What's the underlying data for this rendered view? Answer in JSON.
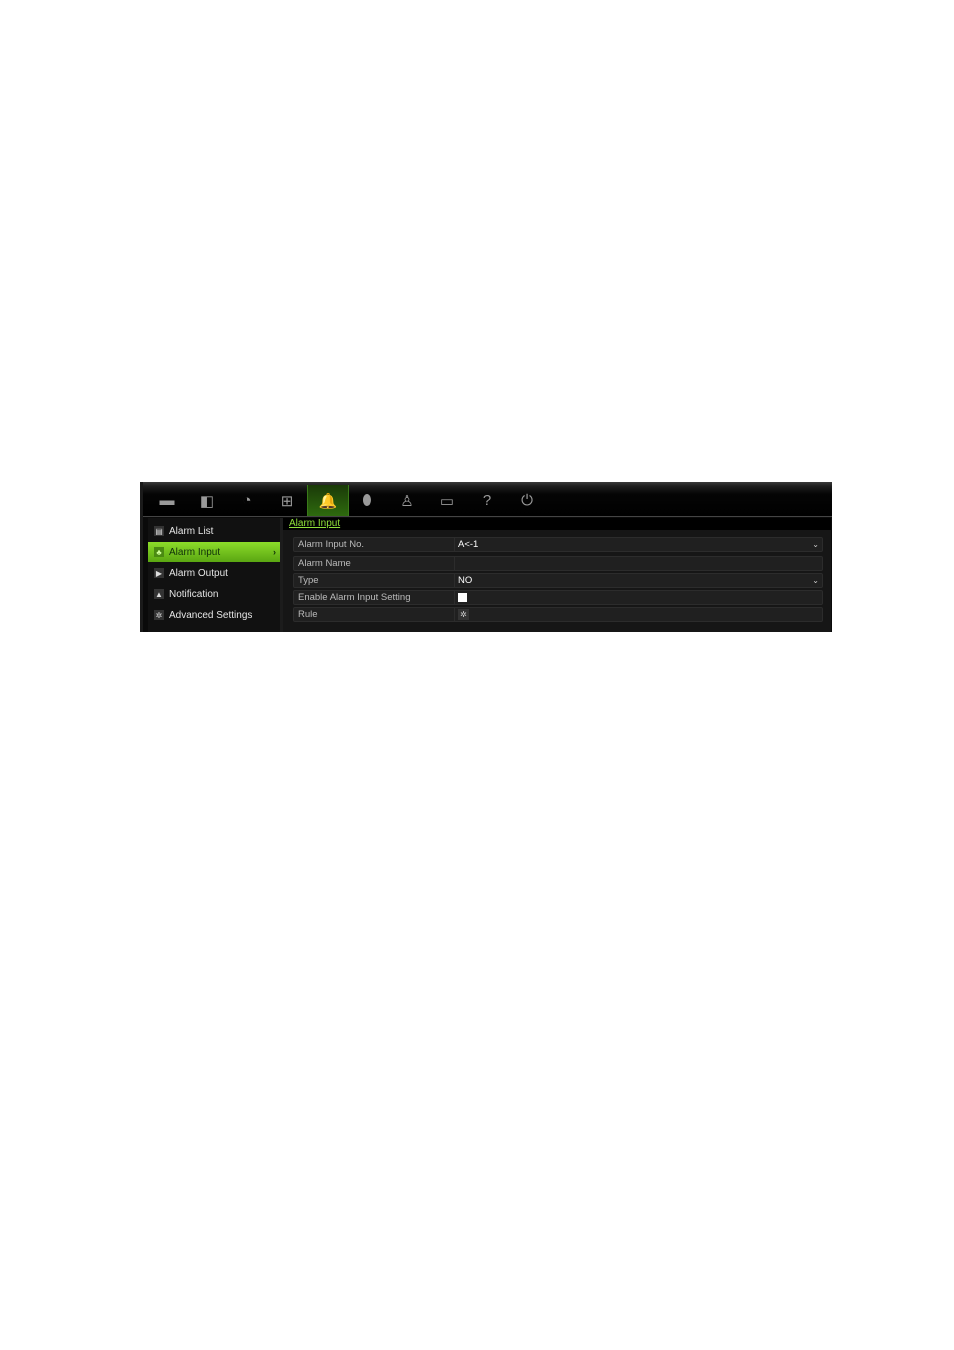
{
  "topbar": {
    "icons": [
      {
        "name": "display-icon",
        "glyph": "▬"
      },
      {
        "name": "camera-icon",
        "glyph": "◧"
      },
      {
        "name": "record-gauge-icon",
        "glyph": "◔"
      },
      {
        "name": "network-icon",
        "glyph": "⊞"
      },
      {
        "name": "alarm-bell-icon",
        "glyph": "🔔",
        "active": true
      },
      {
        "name": "device-icon",
        "glyph": "⬮"
      },
      {
        "name": "user-icon",
        "glyph": "♙"
      },
      {
        "name": "hdd-icon",
        "glyph": "▭"
      },
      {
        "name": "help-icon",
        "glyph": "?"
      },
      {
        "name": "power-icon",
        "glyph": "⏻"
      }
    ]
  },
  "sidebar": {
    "items": [
      {
        "label": "Alarm List",
        "icon": "▤"
      },
      {
        "label": "Alarm Input",
        "icon": "♣",
        "active": true,
        "arrow": "›"
      },
      {
        "label": "Alarm Output",
        "icon": "▶"
      },
      {
        "label": "Notification",
        "icon": "▲"
      },
      {
        "label": "Advanced Settings",
        "icon": "✲"
      }
    ]
  },
  "main": {
    "title": "Alarm Input",
    "fields": {
      "alarm_input_no": {
        "label": "Alarm Input No.",
        "value": "A<-1",
        "dropdown": "⌄"
      },
      "alarm_name": {
        "label": "Alarm Name",
        "value": ""
      },
      "type": {
        "label": "Type",
        "value": "NO",
        "dropdown": "⌄"
      },
      "enable": {
        "label": "Enable Alarm Input Setting",
        "checked": false
      },
      "rule": {
        "label": "Rule",
        "icon": "✲"
      }
    }
  }
}
